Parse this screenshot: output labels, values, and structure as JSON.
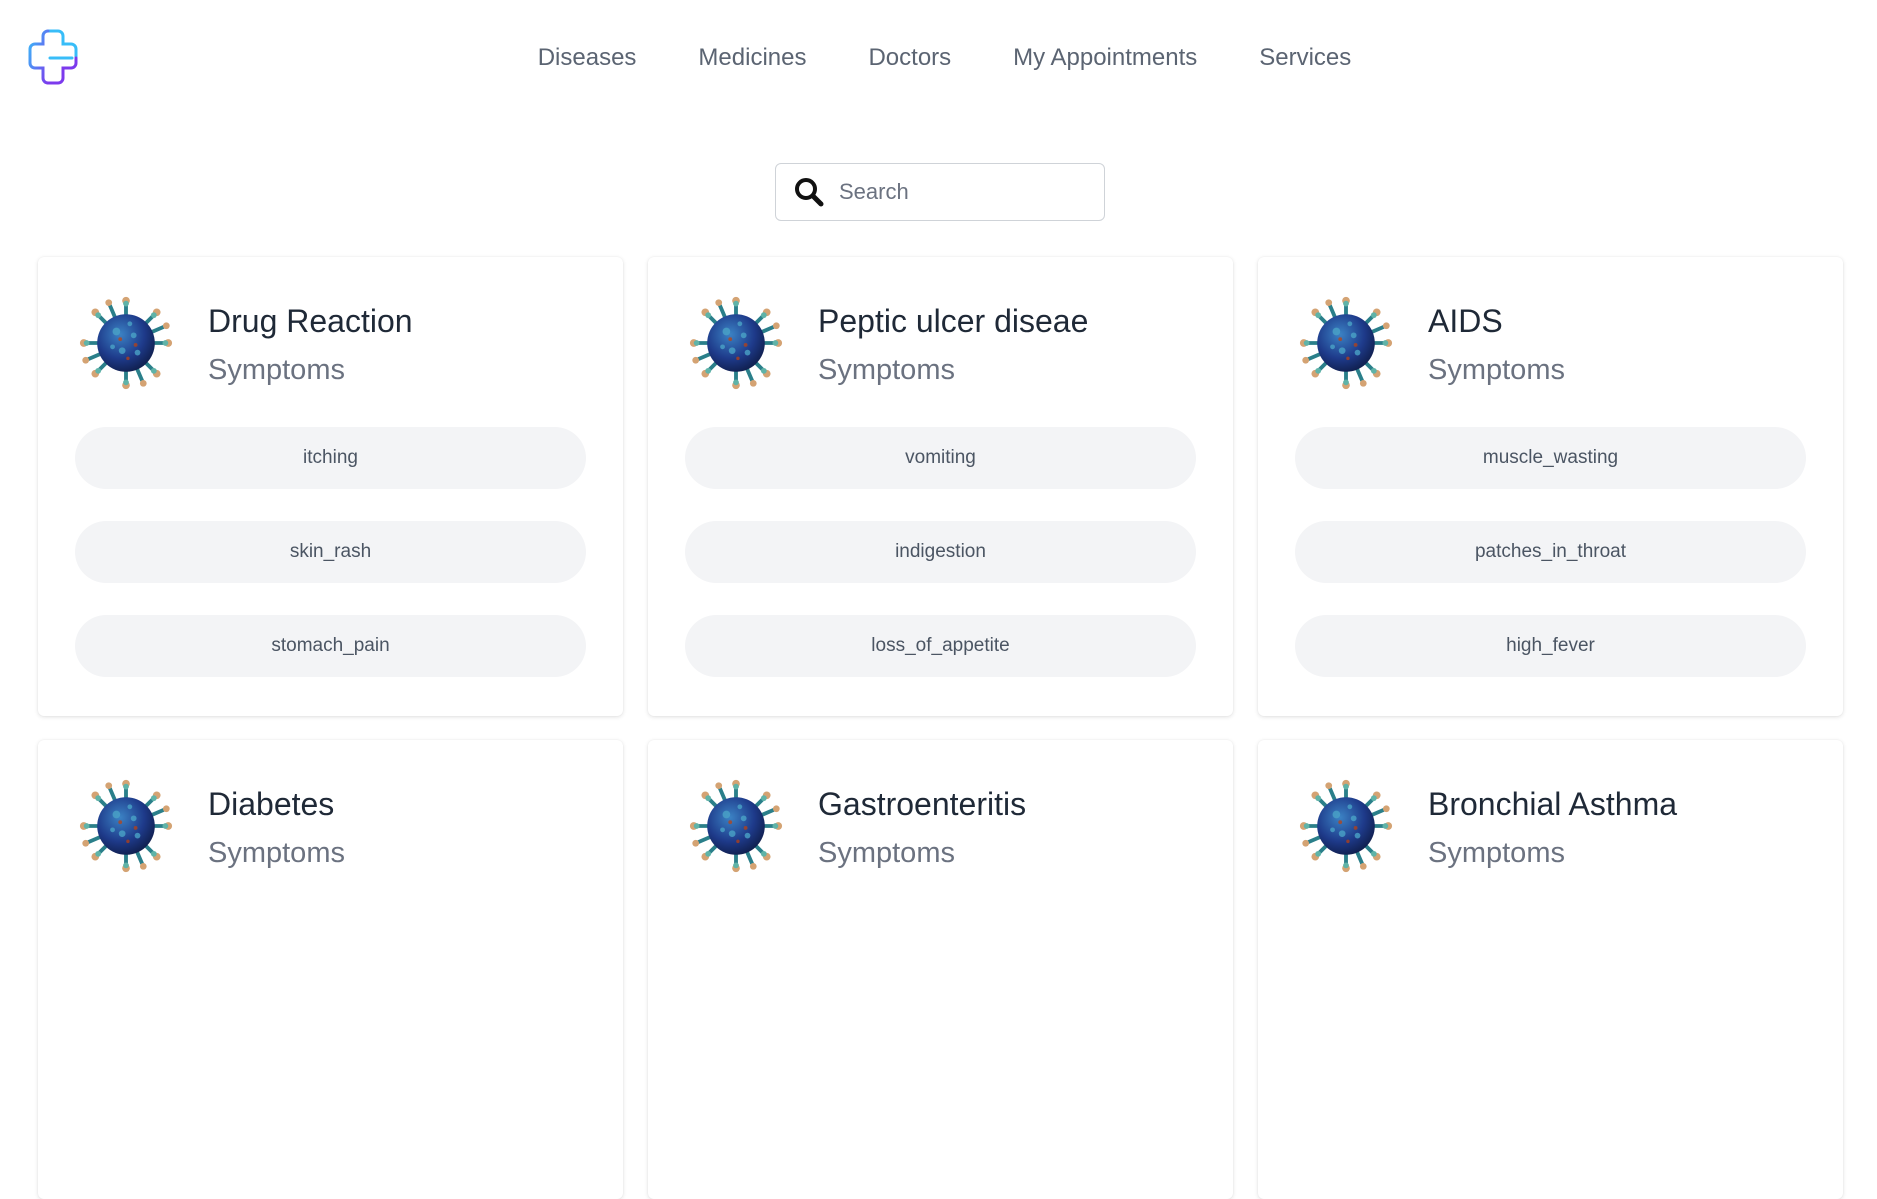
{
  "nav": {
    "items": [
      {
        "label": "Diseases"
      },
      {
        "label": "Medicines"
      },
      {
        "label": "Doctors"
      },
      {
        "label": "My Appointments"
      },
      {
        "label": "Services"
      }
    ]
  },
  "search": {
    "placeholder": "Search",
    "value": ""
  },
  "colors": {
    "logo_cyan": "#38bdf8",
    "logo_purple": "#7c3aed",
    "tag_bg": "#f3f4f6",
    "nav_text": "#5b6472"
  },
  "cards": [
    {
      "title": "Drug Reaction",
      "subtitle": "Symptoms",
      "icon": "virus-icon",
      "symptoms": [
        "itching",
        "skin_rash",
        "stomach_pain"
      ]
    },
    {
      "title": "Peptic ulcer diseae",
      "subtitle": "Symptoms",
      "icon": "virus-icon",
      "symptoms": [
        "vomiting",
        "indigestion",
        "loss_of_appetite"
      ]
    },
    {
      "title": "AIDS",
      "subtitle": "Symptoms",
      "icon": "virus-icon",
      "symptoms": [
        "muscle_wasting",
        "patches_in_throat",
        "high_fever"
      ]
    },
    {
      "title": "Diabetes",
      "subtitle": "Symptoms",
      "icon": "virus-icon",
      "symptoms": []
    },
    {
      "title": "Gastroenteritis",
      "subtitle": "Symptoms",
      "icon": "virus-icon",
      "symptoms": []
    },
    {
      "title": "Bronchial Asthma",
      "subtitle": "Symptoms",
      "icon": "virus-icon",
      "symptoms": []
    }
  ]
}
